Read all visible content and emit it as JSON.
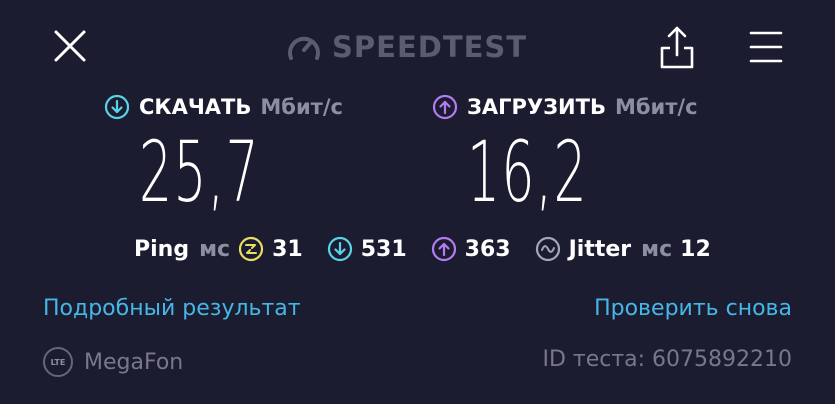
{
  "header": {
    "logo_text": "SPEEDTEST",
    "close_icon": "close-icon",
    "share_icon": "share-icon",
    "menu_icon": "menu-icon"
  },
  "download": {
    "label": "СКАЧАТЬ",
    "unit": "Мбит/с",
    "value": "25,7",
    "icon_color": "#5ad2e8"
  },
  "upload": {
    "label": "ЗАГРУЗИТЬ",
    "unit": "Мбит/с",
    "value": "16,2",
    "icon_color": "#b47cf0"
  },
  "stats": {
    "ping_label": "Ping",
    "ping_unit": "мс",
    "ping_idle": "31",
    "ping_download": "531",
    "ping_upload": "363",
    "jitter_label": "Jitter",
    "jitter_unit": "мс",
    "jitter_value": "12",
    "idle_icon_color": "#e9de61"
  },
  "actions": {
    "details_link": "Подробный результат",
    "retest_link": "Проверить снова"
  },
  "footer": {
    "network_badge": "LTE",
    "carrier": "MegaFon",
    "test_id": "ID теста: 6075892210"
  }
}
